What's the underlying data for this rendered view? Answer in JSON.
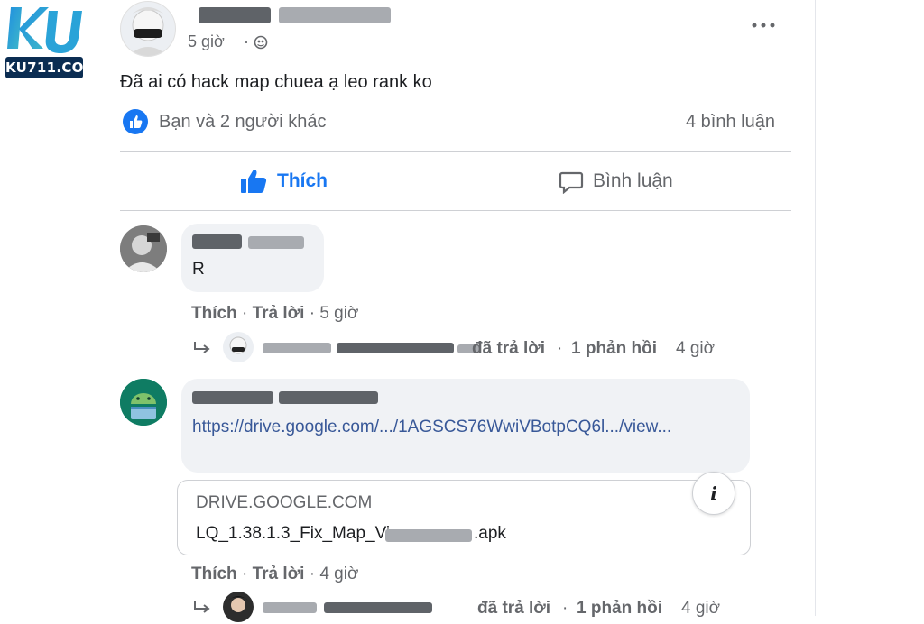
{
  "watermark": {
    "logo_text": "KU",
    "label": "KU711.CO"
  },
  "post": {
    "time": "5 giờ",
    "privacy_icon": "public-globe-icon",
    "more_icon": "more-dots-icon",
    "text": "Đã ai có hack map chuea ạ leo rank ko",
    "reactions_text": "Bạn và 2 người khác",
    "comments_count": "4 bình luận",
    "like_label": "Thích",
    "comment_label": "Bình luận"
  },
  "comments": [
    {
      "text": "R",
      "like": "Thích",
      "reply": "Trả lời",
      "time": "5 giờ",
      "replies_summary_action": "đã trả lời",
      "replies_summary_count": "1 phản hồi",
      "replies_summary_time": "4 giờ"
    },
    {
      "link_text": "https://drive.google.com/.../1AGSCS76WwiVBotpCQ6l.../view...",
      "preview_domain": "DRIVE.GOOGLE.COM",
      "preview_title": "LQ_1.38.1.3_Fix_Map_Vi",
      "preview_title_suffix": ".apk",
      "info_icon": "info-icon",
      "like": "Thích",
      "reply": "Trả lời",
      "time": "4 giờ",
      "replies_summary_action": "đã trả lời",
      "replies_summary_count": "1 phản hồi",
      "replies_summary_time": "4 giờ"
    }
  ],
  "colors": {
    "accent": "#1877f2",
    "muted": "#65676b",
    "bubble": "#f0f2f5"
  }
}
